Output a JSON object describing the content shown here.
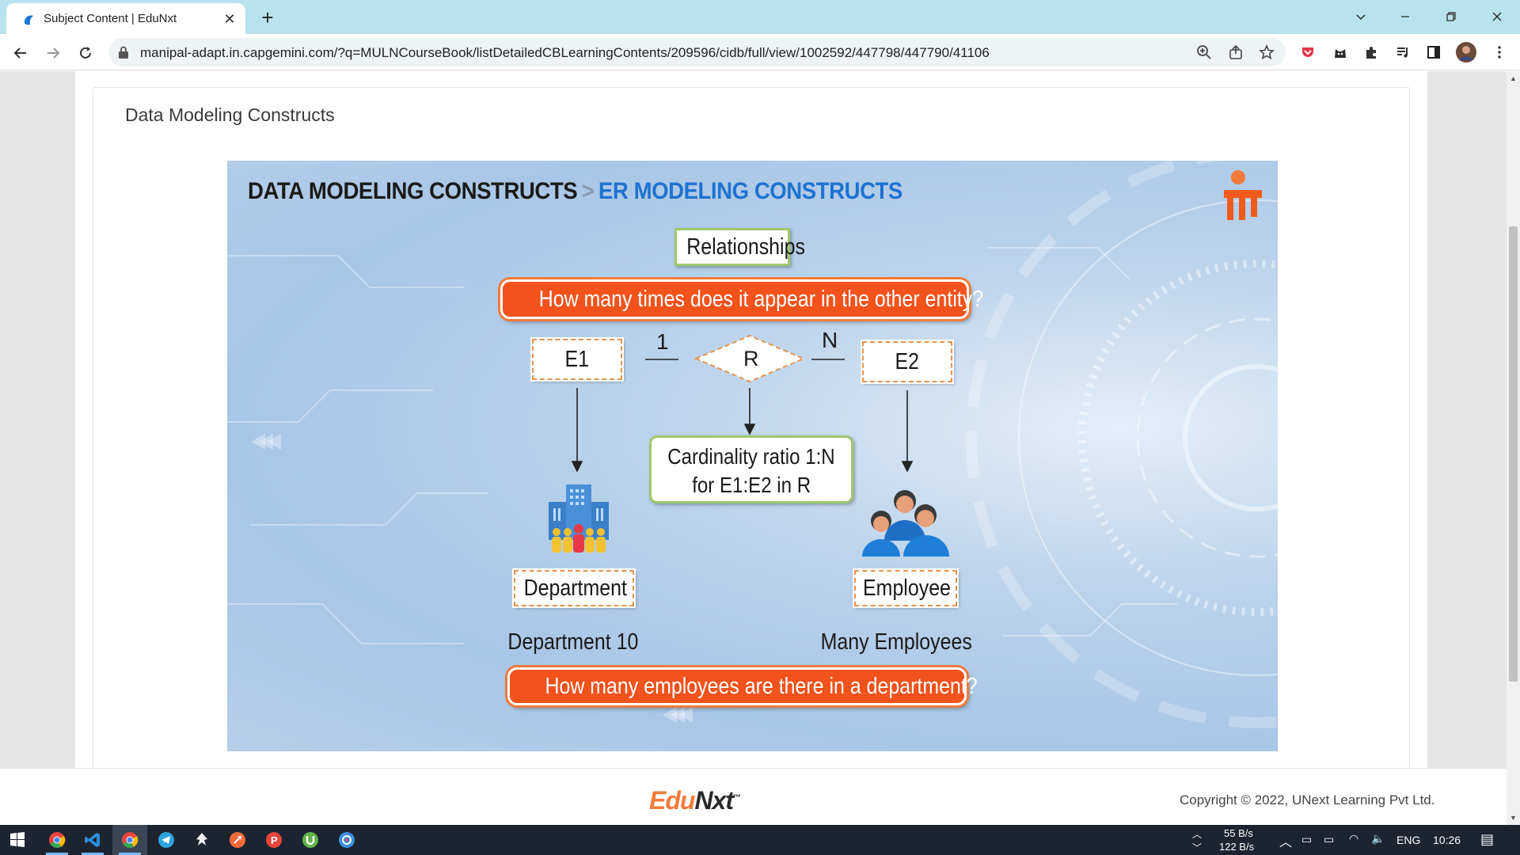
{
  "browser": {
    "tab_title": "Subject Content | EduNxt",
    "url": "manipal-adapt.in.capgemini.com/?q=MULNCourseBook/listDetailedCBLearningContents/209596/cidb/full/view/1002592/447798/447790/41106"
  },
  "page": {
    "title": "Data Modeling Constructs"
  },
  "slide": {
    "heading_part1": "DATA MODELING CONSTRUCTS",
    "heading_sep": ">",
    "heading_part2": "ER MODELING CONSTRUCTS",
    "relationships_label": "Relationships",
    "question_top": "How many times does it appear in the other entity?",
    "entity1": "E1",
    "entity2": "E2",
    "relation": "R",
    "card_left": "1",
    "card_right": "N",
    "cardinality_line1": "Cardinality ratio 1:N",
    "cardinality_line2": "for E1:E2 in R",
    "dept_label": "Department",
    "emp_label": "Employee",
    "dept_caption": "Department 10",
    "emp_caption": "Many Employees",
    "question_bottom": "How many employees are there in a department?"
  },
  "footer": {
    "logo_edu": "Edu",
    "logo_nxt": "Nxt",
    "logo_tm": "™",
    "copyright": "Copyright © 2022, UNext Learning Pvt Ltd."
  },
  "taskbar": {
    "net_up": "55 B/s",
    "net_down": "122 B/s",
    "lang": "ENG",
    "time": "10:26"
  },
  "colors": {
    "accent_orange": "#f2521b",
    "heading_blue": "#1f72d0",
    "tab_strip": "#b8e3ee"
  }
}
